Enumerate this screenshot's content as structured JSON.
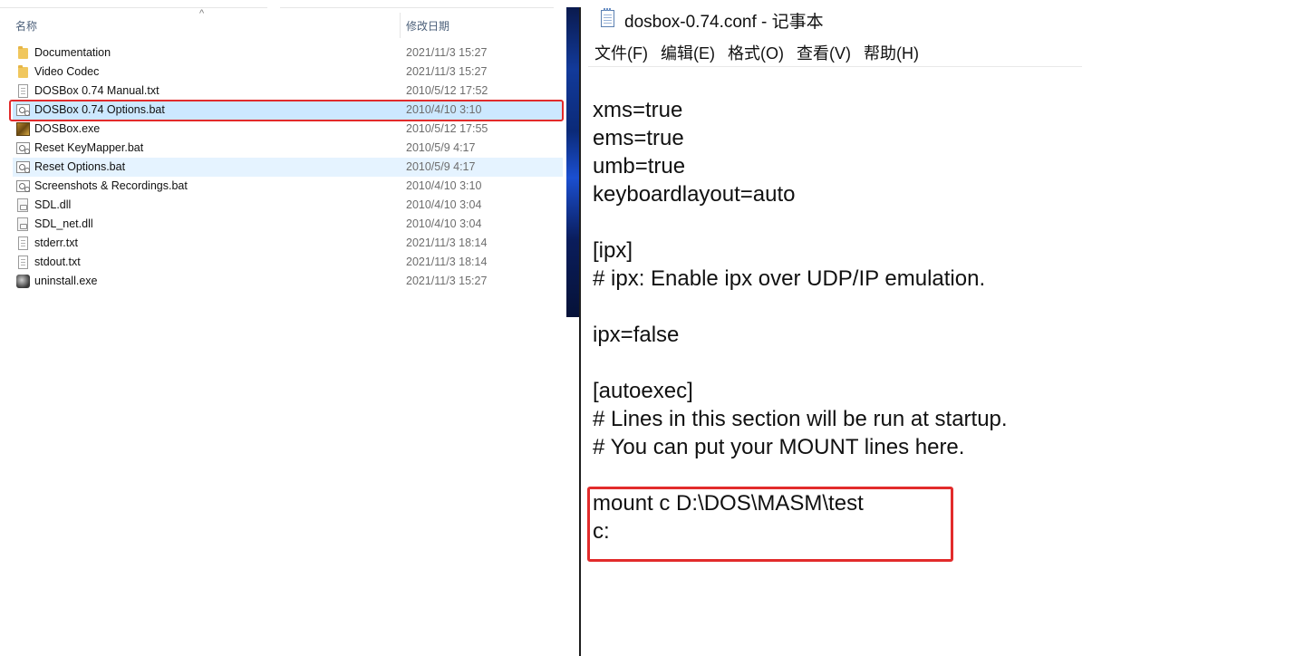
{
  "explorer": {
    "columns": {
      "name": "名称",
      "date": "修改日期"
    },
    "files": [
      {
        "name": "Documentation",
        "date": "2021/11/3 15:27",
        "icon": "folder-icon"
      },
      {
        "name": "Video Codec",
        "date": "2021/11/3 15:27",
        "icon": "folder-icon"
      },
      {
        "name": "DOSBox 0.74 Manual.txt",
        "date": "2010/5/12 17:52",
        "icon": "text-file-icon"
      },
      {
        "name": "DOSBox 0.74 Options.bat",
        "date": "2010/4/10 3:10",
        "icon": "batch-file-icon"
      },
      {
        "name": "DOSBox.exe",
        "date": "2010/5/12 17:55",
        "icon": "dosbox-exe-icon"
      },
      {
        "name": "Reset KeyMapper.bat",
        "date": "2010/5/9 4:17",
        "icon": "batch-file-icon"
      },
      {
        "name": "Reset Options.bat",
        "date": "2010/5/9 4:17",
        "icon": "batch-file-icon"
      },
      {
        "name": "Screenshots & Recordings.bat",
        "date": "2010/4/10 3:10",
        "icon": "batch-file-icon"
      },
      {
        "name": "SDL.dll",
        "date": "2010/4/10 3:04",
        "icon": "dll-file-icon"
      },
      {
        "name": "SDL_net.dll",
        "date": "2010/4/10 3:04",
        "icon": "dll-file-icon"
      },
      {
        "name": "stderr.txt",
        "date": "2021/11/3 18:14",
        "icon": "text-file-icon"
      },
      {
        "name": "stdout.txt",
        "date": "2021/11/3 18:14",
        "icon": "text-file-icon"
      },
      {
        "name": "uninstall.exe",
        "date": "2021/11/3 15:27",
        "icon": "uninstall-exe-icon"
      }
    ]
  },
  "notepad": {
    "title": "dosbox-0.74.conf - 记事本",
    "menu": [
      "文件(F)",
      "编辑(E)",
      "格式(O)",
      "查看(V)",
      "帮助(H)"
    ],
    "lines": [
      "xms=true",
      "ems=true",
      "umb=true",
      "keyboardlayout=auto",
      "",
      "[ipx]",
      "# ipx: Enable ipx over UDP/IP emulation.",
      "",
      "ipx=false",
      "",
      "[autoexec]",
      "# Lines in this section will be run at startup.",
      "# You can put your MOUNT lines here.",
      "",
      "mount c D:\\DOS\\MASM\\test",
      "c:"
    ]
  },
  "colors": {
    "highlight": "#e22b2b",
    "selection": "#cce8ff",
    "hover": "#e5f3ff"
  }
}
